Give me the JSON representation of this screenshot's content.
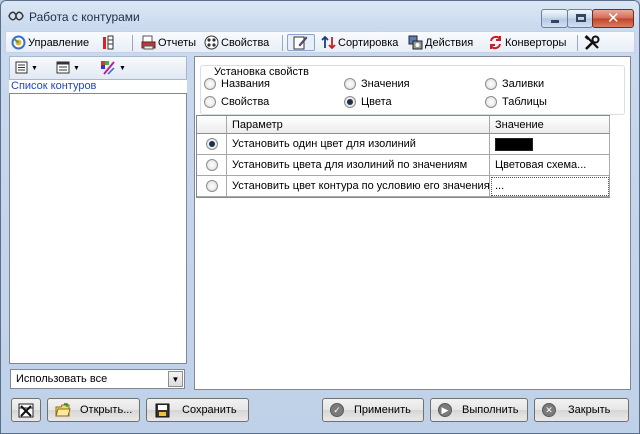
{
  "window": {
    "title": "Работа с контурами"
  },
  "menu": {
    "items": [
      {
        "label": "Управление",
        "icon": "manage-icon"
      },
      {
        "label": "",
        "icon": "columns-icon"
      },
      {
        "label": "Отчеты",
        "icon": "reports-icon"
      },
      {
        "label": "Свойства",
        "icon": "properties-icon"
      },
      {
        "label": "",
        "icon": "edit-icon"
      },
      {
        "label": "Сортировка",
        "icon": "sort-icon"
      },
      {
        "label": "Действия",
        "icon": "actions-icon"
      },
      {
        "label": "Конверторы",
        "icon": "converters-icon"
      },
      {
        "label": "",
        "icon": "tools-icon"
      }
    ]
  },
  "left_panel": {
    "list_header": "Список контуров",
    "combo_value": "Использовать все"
  },
  "settings": {
    "legend": "Установка свойств",
    "options": [
      {
        "label": "Названия",
        "selected": false
      },
      {
        "label": "Значения",
        "selected": false
      },
      {
        "label": "Заливки",
        "selected": false
      },
      {
        "label": "Свойства",
        "selected": false
      },
      {
        "label": "Цвета",
        "selected": true
      },
      {
        "label": "Таблицы",
        "selected": false
      }
    ]
  },
  "grid": {
    "columns": [
      "Параметр",
      "Значение"
    ],
    "rows": [
      {
        "selected": true,
        "param": "Установить один цвет для изолиний",
        "value": "",
        "swatch_color": "#000000"
      },
      {
        "selected": false,
        "param": "Установить цвета для изолиний по значениям",
        "value": "Цветовая схема..."
      },
      {
        "selected": false,
        "param": "Установить цвет контура по условию его значения",
        "value": "..."
      }
    ]
  },
  "buttons": {
    "open": "Открыть...",
    "save": "Сохранить",
    "apply": "Применить",
    "execute": "Выполнить",
    "close": "Закрыть"
  }
}
